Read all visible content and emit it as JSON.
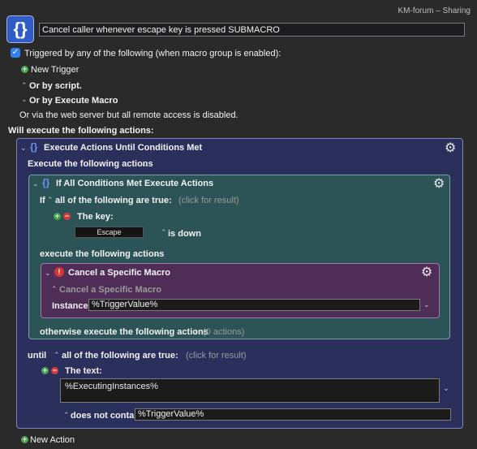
{
  "window": {
    "title": "KM-forum – Sharing"
  },
  "macro": {
    "name": "Cancel caller whenever escape key is pressed SUBMACRO"
  },
  "triggers": {
    "header": "Triggered by any of the following (when macro group is enabled):",
    "new_trigger": "New Trigger",
    "by_script": "Or by script.",
    "by_execute_macro": "Or by Execute Macro",
    "web_server": "Or via the web server but all remote access is disabled."
  },
  "actions_header": "Will execute the following actions:",
  "loop_action": {
    "title": "Execute Actions Until Conditions Met",
    "execute_label": "Execute the following actions",
    "until_label": "until",
    "until_condition": "all of the following are true:",
    "click_result": "(click for result)",
    "text_condition_label": "The text:",
    "text_value": "%ExecutingInstances%",
    "contain_operator": "does not contain",
    "contain_value": "%TriggerValue%"
  },
  "if_action": {
    "title": "If All Conditions Met Execute Actions",
    "if_label": "If",
    "condition": "all of the following are true:",
    "click_result": "(click for result)",
    "key_label": "The key:",
    "key_value": "Escape",
    "key_state": "is down",
    "execute_label": "execute the following actions",
    "otherwise_label": "otherwise execute the following actions",
    "otherwise_count": "(0 actions)"
  },
  "cancel_action": {
    "title": "Cancel a Specific Macro",
    "subtitle": "Cancel a Specific Macro",
    "instance_label": "Instance:",
    "instance_value": "%TriggerValue%"
  },
  "new_action": "New Action",
  "icons": {
    "macro": "curly-braces-icon",
    "gear": "gear-icon",
    "plus": "plus-circle-icon",
    "minus": "minus-circle-icon",
    "error": "exclamation-circle-icon"
  },
  "colors": {
    "background": "#2a2a2b",
    "loop_box": "#2a2f5c",
    "if_box": "#2c5456",
    "cancel_box": "#4e2e56",
    "accent_blue": "#2f7ff7",
    "plus_green": "#46a548",
    "minus_red": "#d33b3b"
  }
}
